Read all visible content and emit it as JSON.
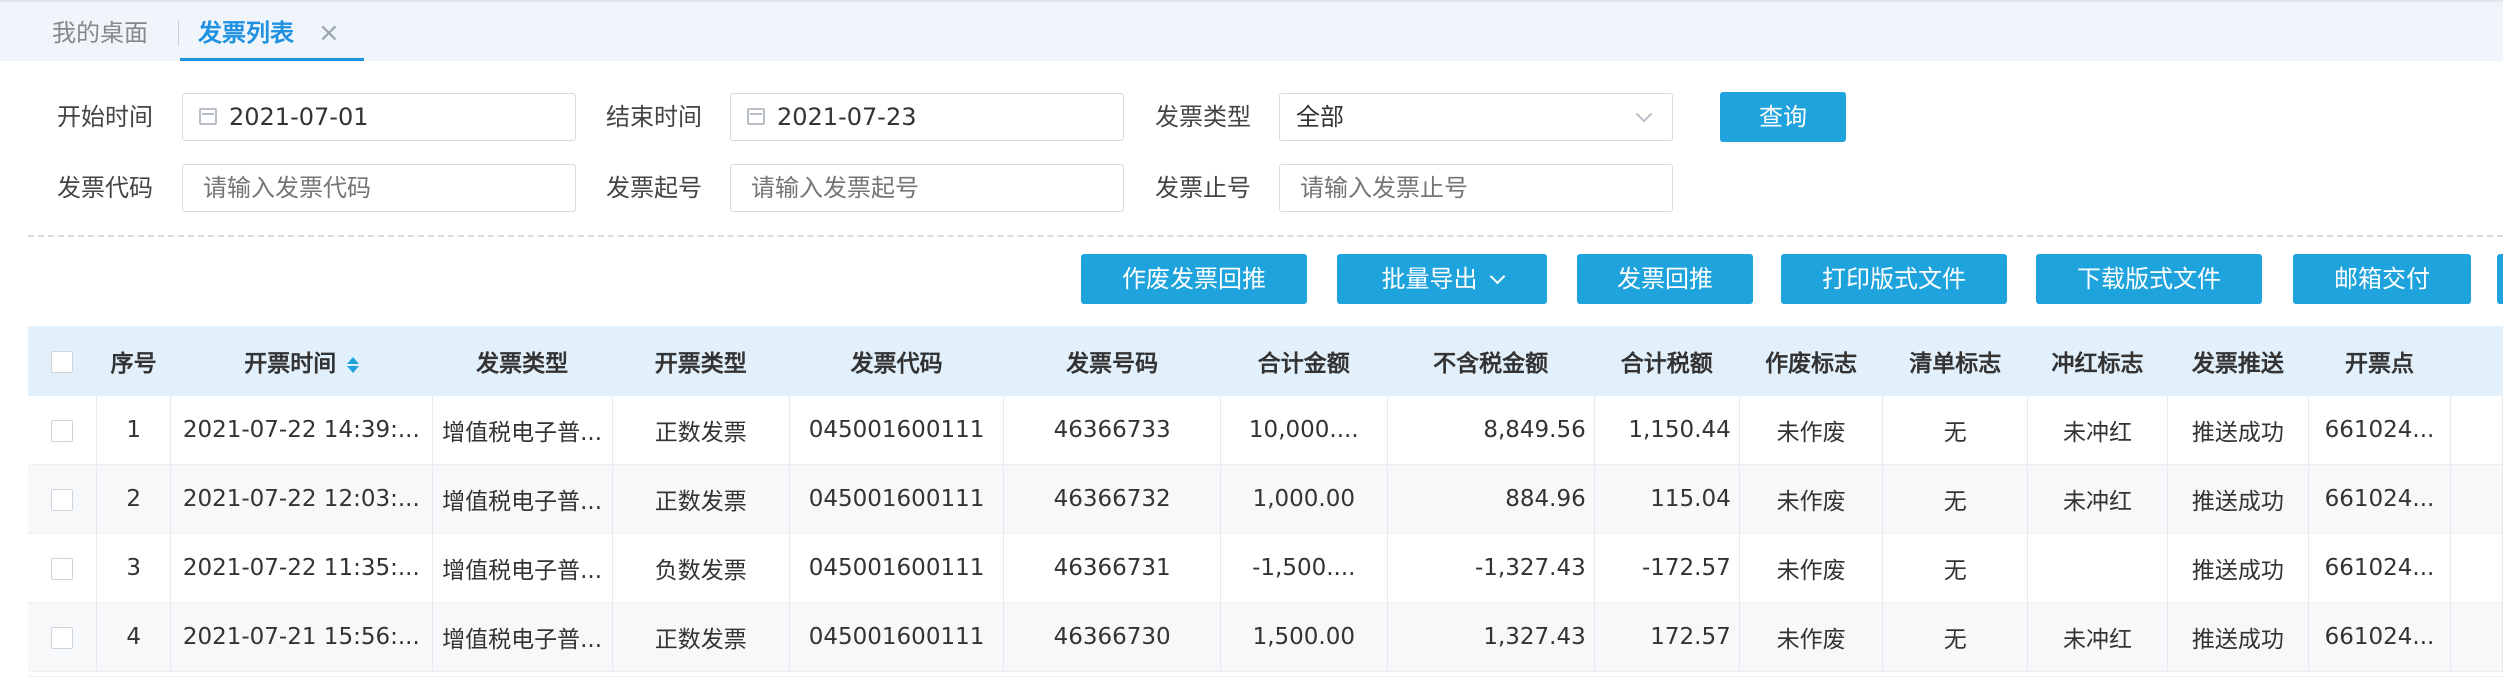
{
  "tabs": {
    "desk_label": "我的桌面",
    "active_label": "发票列表",
    "close_glyph": "×"
  },
  "filters": {
    "start_label": "开始时间",
    "start_value": "2021-07-01",
    "end_label": "结束时间",
    "end_value": "2021-07-23",
    "type_label": "发票类型",
    "type_value": "全部",
    "query_label": "查询",
    "code_label": "发票代码",
    "code_placeholder": "请输入发票代码",
    "start_no_label": "发票起号",
    "start_no_placeholder": "请输入发票起号",
    "end_no_label": "发票止号",
    "end_no_placeholder": "请输入发票止号"
  },
  "toolbar": {
    "void_push": "作废发票回推",
    "batch_export": "批量导出",
    "invoice_push": "发票回推",
    "print_file": "打印版式文件",
    "download_file": "下载版式文件",
    "mailbox_delivery": "邮箱交付"
  },
  "table": {
    "headers": {
      "index": "序号",
      "issue_time": "开票时间",
      "invoice_type": "发票类型",
      "issue_type": "开票类型",
      "invoice_code": "发票代码",
      "invoice_number": "发票号码",
      "total_amount": "合计金额",
      "amount_ex_tax": "不含税金额",
      "total_tax": "合计税额",
      "void_flag": "作废标志",
      "list_flag": "清单标志",
      "red_flag": "冲红标志",
      "push": "发票推送",
      "point": "开票点"
    },
    "rows": [
      {
        "index": "1",
        "time": "2021-07-22 14:39:...",
        "type": "增值税电子普...",
        "issue_type": "正数发票",
        "code": "045001600111",
        "number": "46366733",
        "total": "10,000....",
        "ex_tax": "8,849.56",
        "tax": "1,150.44",
        "void": "未作废",
        "list": "无",
        "red": "未冲红",
        "push": "推送成功",
        "point": "661024..."
      },
      {
        "index": "2",
        "time": "2021-07-22 12:03:...",
        "type": "增值税电子普...",
        "issue_type": "正数发票",
        "code": "045001600111",
        "number": "46366732",
        "total": "1,000.00",
        "ex_tax": "884.96",
        "tax": "115.04",
        "void": "未作废",
        "list": "无",
        "red": "未冲红",
        "push": "推送成功",
        "point": "661024..."
      },
      {
        "index": "3",
        "time": "2021-07-22 11:35:...",
        "type": "增值税电子普...",
        "issue_type": "负数发票",
        "code": "045001600111",
        "number": "46366731",
        "total": "-1,500....",
        "ex_tax": "-1,327.43",
        "tax": "-172.57",
        "void": "未作废",
        "list": "无",
        "red": "",
        "push": "推送成功",
        "point": "661024..."
      },
      {
        "index": "4",
        "time": "2021-07-21 15:56:...",
        "type": "增值税电子普...",
        "issue_type": "正数发票",
        "code": "045001600111",
        "number": "46366730",
        "total": "1,500.00",
        "ex_tax": "1,327.43",
        "tax": "172.57",
        "void": "未作废",
        "list": "无",
        "red": "未冲红",
        "push": "推送成功",
        "point": "661024..."
      }
    ]
  },
  "colors": {
    "accent": "#1fa3dc",
    "tab_active": "#1f91e0",
    "header_bg": "#e2f0fb"
  }
}
